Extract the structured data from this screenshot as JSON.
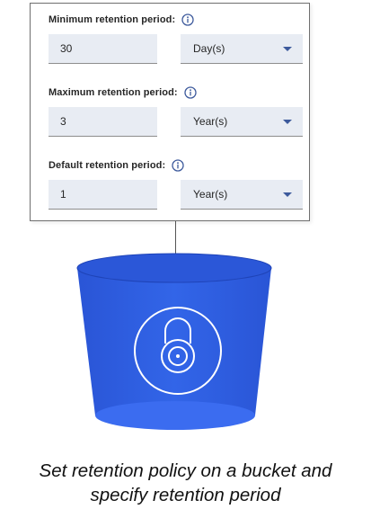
{
  "retention_form": {
    "fields": [
      {
        "label": "Minimum retention period:",
        "value": "30",
        "unit": "Day(s)",
        "info_icon": "info-icon"
      },
      {
        "label": "Maximum retention period:",
        "value": "3",
        "unit": "Year(s)",
        "info_icon": "info-icon"
      },
      {
        "label": "Default retention period:",
        "value": "1",
        "unit": "Year(s)",
        "info_icon": "info-icon"
      }
    ]
  },
  "illustration": {
    "bucket_icon": "bucket-icon",
    "lock_icon": "padlock-icon",
    "colors": {
      "bucket_primary": "#2f5ee0",
      "bucket_dark": "#1c3fb8",
      "bucket_light": "#4a78f0",
      "input_fill": "#e8ecf3",
      "chevron": "#3d5a9c",
      "info_icon": "#3d5a9c"
    }
  },
  "caption": {
    "line1": "Set retention policy on a bucket and",
    "line2": "specify retention period"
  }
}
